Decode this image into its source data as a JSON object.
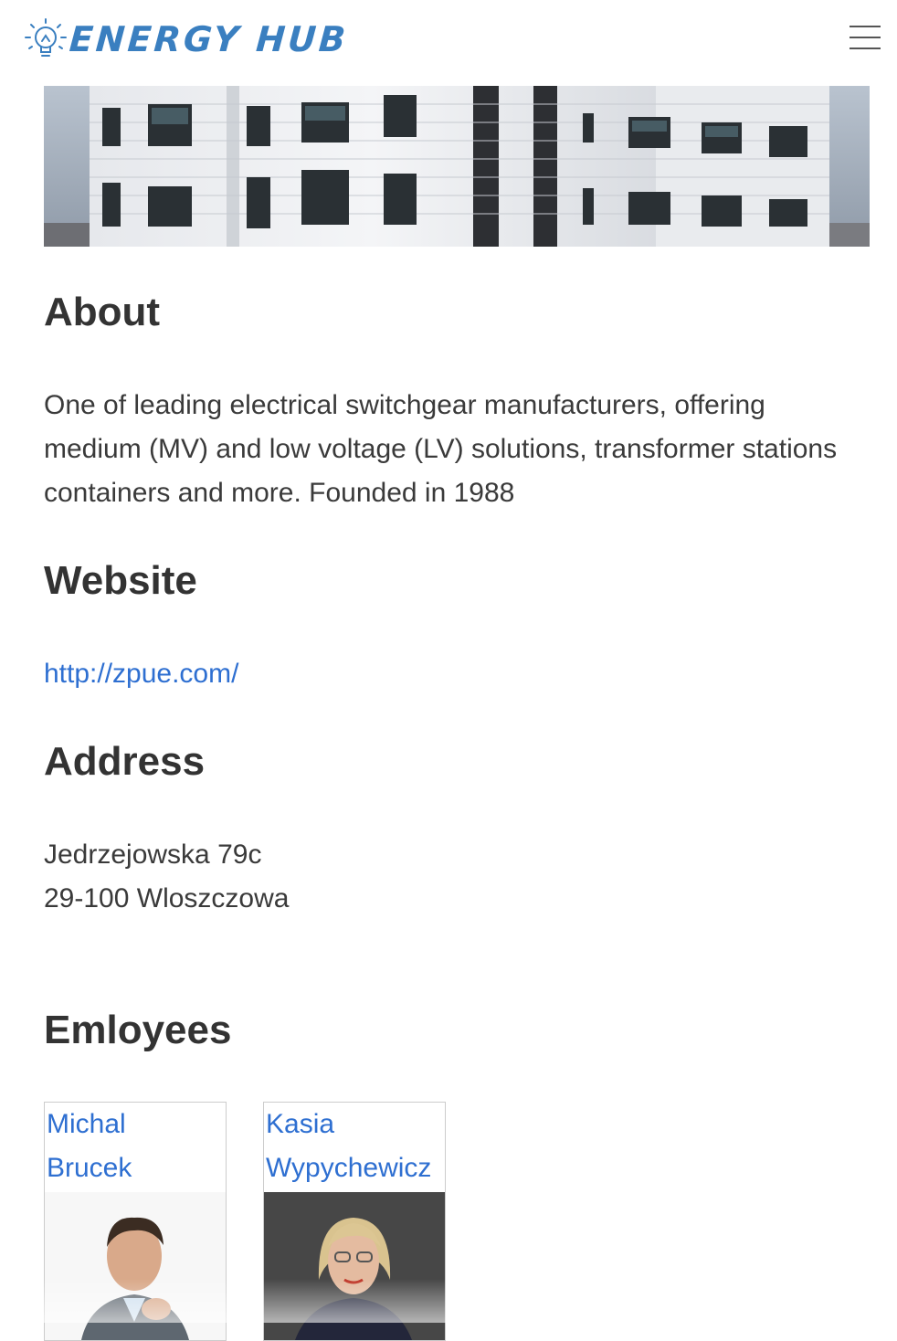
{
  "brand": {
    "name": "ENERGY HUB",
    "color": "#3a7fc0",
    "icon": "lightbulb-icon"
  },
  "nav": {
    "menu_icon": "hamburger-menu-icon"
  },
  "hero": {
    "image": "office-building-facade"
  },
  "about": {
    "heading": "About",
    "text": "One of leading electrical switchgear manufacturers, offering medium (MV) and low voltage (LV) solutions, transformer stations containers and more. Founded in 1988"
  },
  "website": {
    "heading": "Website",
    "url": "http://zpue.com/"
  },
  "address": {
    "heading": "Address",
    "line1": "Jedrzejowska 79c",
    "line2": "29-100 Wloszczowa"
  },
  "employees": {
    "heading": "Emloyees",
    "items": [
      {
        "first": "Michal",
        "last": "Brucek"
      },
      {
        "first": "Kasia",
        "last": "Wypychewicz"
      }
    ]
  },
  "colors": {
    "link": "#2e6fd1",
    "text": "#333333"
  }
}
